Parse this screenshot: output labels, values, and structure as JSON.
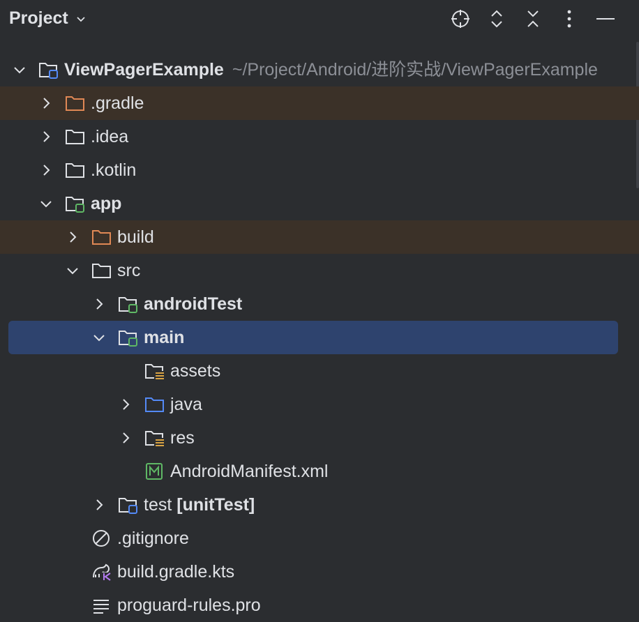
{
  "header": {
    "title": "Project",
    "actions": [
      "locate-icon",
      "expand-all-icon",
      "collapse-all-icon",
      "more-icon",
      "minimize-icon"
    ]
  },
  "tree": {
    "root": {
      "label": "ViewPagerExample",
      "path": "~/Project/Android/进阶实战/ViewPagerExample"
    },
    "items": [
      {
        "label": ".gradle"
      },
      {
        "label": ".idea"
      },
      {
        "label": ".kotlin"
      },
      {
        "label": "app"
      },
      {
        "label": "build"
      },
      {
        "label": "src"
      },
      {
        "label": "androidTest"
      },
      {
        "label": "main"
      },
      {
        "label": "assets"
      },
      {
        "label": "java"
      },
      {
        "label": "res"
      },
      {
        "label": "AndroidManifest.xml"
      },
      {
        "label": "test",
        "suffix": "[unitTest]"
      },
      {
        "label": ".gitignore"
      },
      {
        "label": "build.gradle.kts"
      },
      {
        "label": "proguard-rules.pro"
      }
    ]
  },
  "colors": {
    "background": "#2b2d30",
    "selection": "#2e436e",
    "excluded_highlight": "#3b3128",
    "excluded_folder": "#e08855",
    "module_badge": "#5fb865",
    "source_folder": "#548af7",
    "resource_lines": "#d9a343",
    "kotlin": "#b37bf0"
  }
}
